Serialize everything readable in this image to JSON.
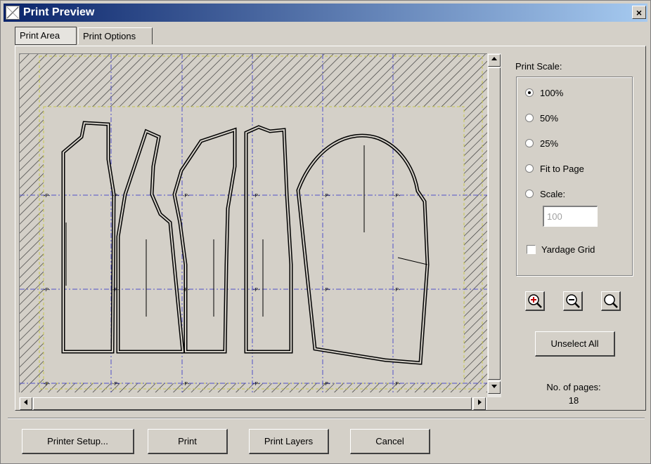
{
  "window": {
    "title": "Print Preview",
    "close_glyph": "×"
  },
  "tabs": [
    {
      "label": "Print Area",
      "active": true
    },
    {
      "label": "Print Options",
      "active": false
    }
  ],
  "print_scale": {
    "label": "Print Scale:",
    "options": [
      "100%",
      "50%",
      "25%",
      "Fit to Page",
      "Scale:"
    ],
    "selected": "100%",
    "scale_value": "100",
    "yardage_grid_label": "Yardage Grid",
    "yardage_grid_checked": false
  },
  "zoom": {
    "icons": [
      "zoom-in-icon",
      "zoom-out-icon",
      "zoom-fit-icon"
    ]
  },
  "unselect_all_label": "Unselect All",
  "pages": {
    "label": "No. of pages:",
    "count": "18"
  },
  "footer": {
    "printer_setup_label": "Printer Setup...",
    "print_label": "Print",
    "print_layers_label": "Print Layers",
    "cancel_label": "Cancel"
  },
  "colors": {
    "title_gradient_start": "#0a246a",
    "title_gradient_end": "#a6caf0",
    "dialog_bg": "#d4d0c8",
    "page_grid_line": "#5050c8",
    "print_area_border": "#c8c850",
    "pattern_outline": "#000000"
  }
}
